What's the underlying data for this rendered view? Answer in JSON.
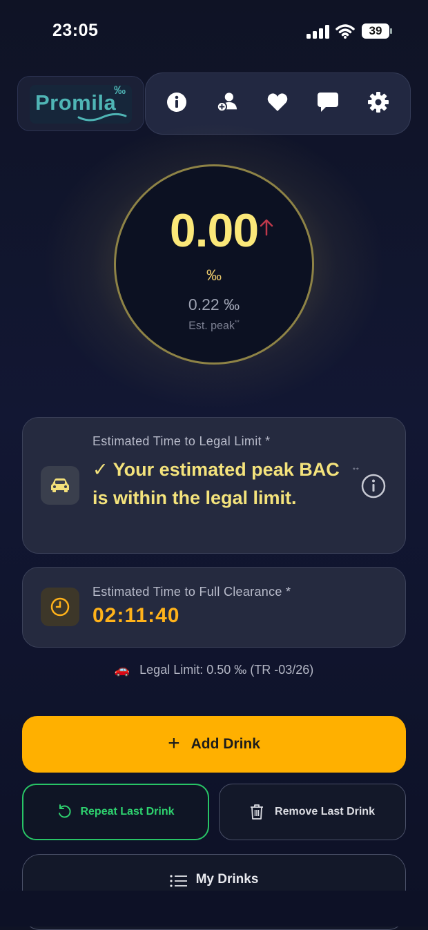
{
  "status_bar": {
    "time": "23:05",
    "battery": "39"
  },
  "header": {
    "logo_text": "Promila",
    "logo_mark": "‰",
    "icons": [
      "info-icon",
      "add-user-icon",
      "heart-icon",
      "chat-icon",
      "gear-icon"
    ]
  },
  "gauge": {
    "bac_value": "0.00",
    "unit": "‰",
    "peak_value": "0.22 ‰",
    "peak_label": "Est. peak",
    "peak_marker": "**",
    "trend": "arrow-up-icon"
  },
  "legal_card": {
    "label": "Estimated Time to Legal Limit *",
    "status": "✓ Your estimated peak BAC is within the legal limit.",
    "note_marker": "**",
    "icon": "car-icon"
  },
  "clearance_card": {
    "label": "Estimated Time to Full Clearance *",
    "timer": "02:11:40",
    "icon": "clock-icon"
  },
  "legal_limit": {
    "emoji": "🚗",
    "text": "Legal Limit: 0.50 ‰ (TR -03/26)"
  },
  "buttons": {
    "add": "Add Drink",
    "repeat": "Repeat Last Drink",
    "remove": "Remove Last Drink",
    "my_drinks": "My Drinks"
  },
  "colors": {
    "accent": "#ffb000",
    "bac_text": "#fbe879",
    "success": "#28c466",
    "trend_up": "#c0394b"
  }
}
